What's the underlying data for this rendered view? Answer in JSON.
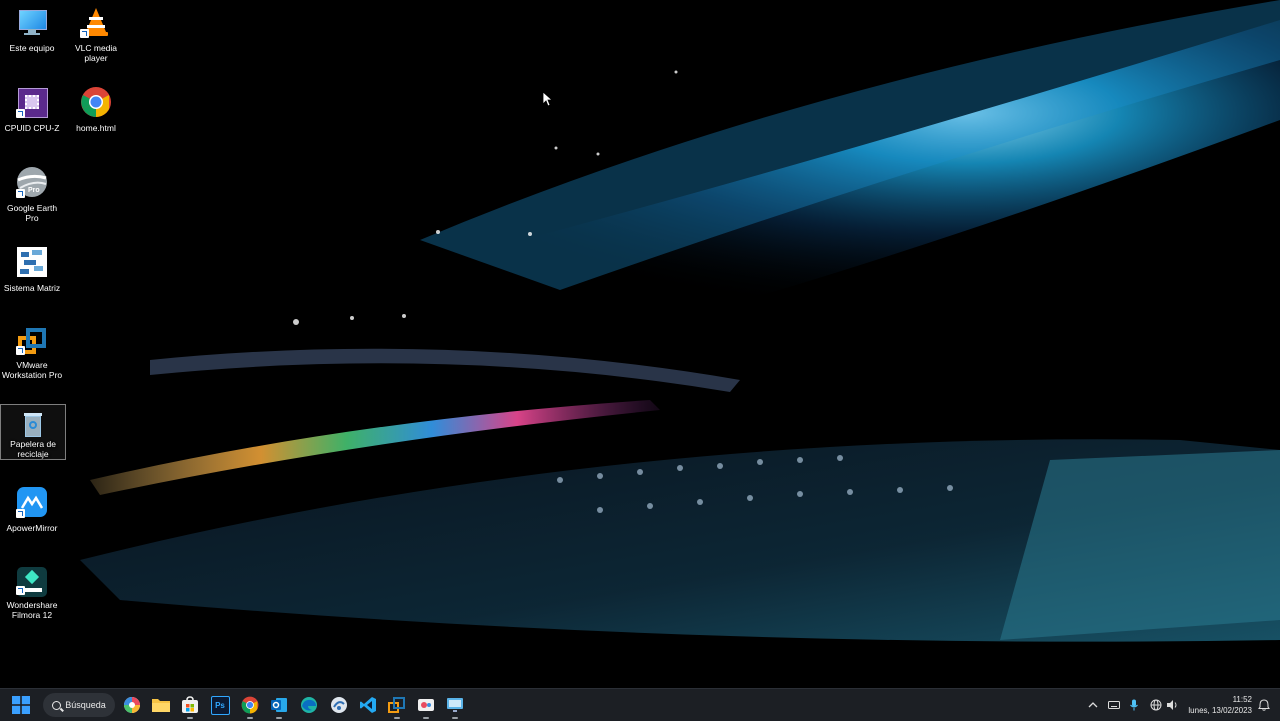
{
  "desktop": {
    "icons": [
      {
        "label": "Este equipo",
        "icon": "monitor-icon"
      },
      {
        "label": "VLC media player",
        "icon": "vlc-cone-icon"
      },
      {
        "label": "CPUID CPU-Z",
        "icon": "cpu-z-icon"
      },
      {
        "label": "home.html",
        "icon": "chrome-icon"
      },
      {
        "label": "Google Earth Pro",
        "icon": "google-earth-icon",
        "badge": "Pro"
      },
      {
        "label": "Sistema Matriz",
        "icon": "sistema-matriz-icon"
      },
      {
        "label": "VMware Workstation Pro",
        "icon": "vmware-icon"
      },
      {
        "label": "Papelera de reciclaje",
        "icon": "recycle-bin-icon"
      },
      {
        "label": "ApowerMirror",
        "icon": "apowermirror-icon"
      },
      {
        "label": "Wondershare Filmora 12",
        "icon": "filmora-icon"
      }
    ]
  },
  "taskbar": {
    "search_label": "Búsqueda",
    "apps": [
      "start-icon",
      "copilot-icon",
      "file-explorer-icon",
      "store-icon",
      "photoshop-icon",
      "chrome-icon",
      "outlook-icon",
      "edge-icon",
      "vpn-icon",
      "vscode-icon",
      "vmware-icon",
      "snipping-icon",
      "remote-desktop-icon"
    ],
    "ps_label": "Ps",
    "tray": {
      "time": "11:52",
      "date": "lunes, 13/02/2023"
    }
  },
  "colors": {
    "taskbar_bg": "#1c1f24",
    "accent": "#0a84ff"
  }
}
